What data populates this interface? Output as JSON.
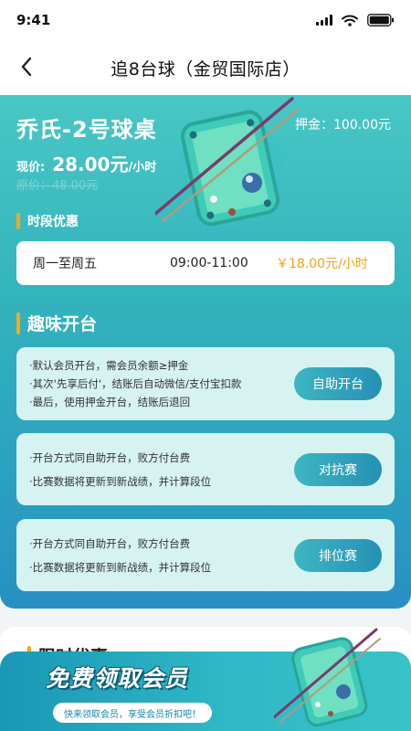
{
  "status": {
    "time": "9:41"
  },
  "nav": {
    "title": "追8台球（金贸国际店）"
  },
  "table": {
    "name": "乔氏-2号球桌",
    "deposit": "押金：100.00元",
    "price_label": "现价:",
    "price_value": "28.00元",
    "price_unit": "/小时",
    "original_price": "原价：48.00元"
  },
  "period_section": {
    "title": "时段优惠",
    "row": {
      "days": "周一至周五",
      "time": "09:00-11:00",
      "price": "￥18.00元/小时"
    }
  },
  "fun_section": {
    "title": "趣味开台",
    "cards": [
      {
        "rules": [
          "·默认会员开台，需会员余额≥押金",
          "·其次'先享后付'，结账后自动微信/支付宝扣款",
          "·最后，使用押金开台，结账后退回"
        ],
        "button": "自助开台"
      },
      {
        "rules": [
          "·开台方式同自助开台，败方付台费",
          "·比赛数据将更新到新战绩，并计算段位"
        ],
        "button": "对抗赛"
      },
      {
        "rules": [
          "·开台方式同自助开台，败方付台费",
          "·比赛数据将更新到新战绩，并计算段位"
        ],
        "button": "排位赛"
      }
    ]
  },
  "limited_section": {
    "title": "限时优惠"
  },
  "banner": {
    "title": "免费领取会员",
    "subtitle": "快来领取会员，享受会员折扣吧！"
  },
  "colors": {
    "accent_orange": "#f5a017",
    "teal": "#33b3bd",
    "blue": "#2890c4"
  }
}
